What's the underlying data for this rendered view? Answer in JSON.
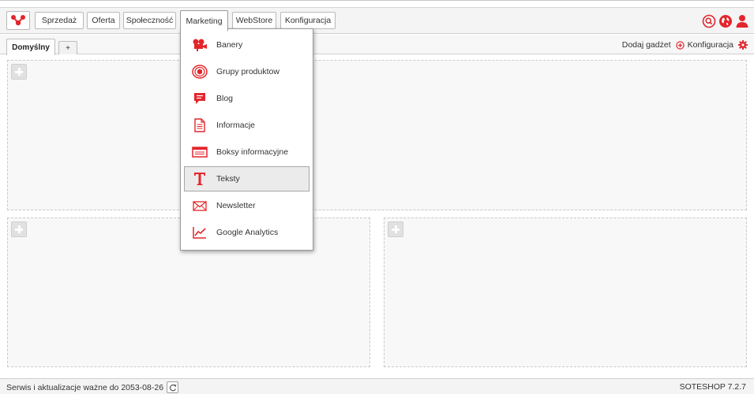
{
  "colors": {
    "accent": "#e3262c",
    "frame": "#d0d0d0",
    "box_bg": "#f8f8f8"
  },
  "topnav": {
    "logo_icon": "molecule-logo-icon",
    "items": [
      {
        "label": "Sprzedaż"
      },
      {
        "label": "Oferta"
      },
      {
        "label": "Społeczność"
      },
      {
        "label": "Marketing",
        "active": true
      },
      {
        "label": "WebStore"
      },
      {
        "label": "Konfiguracja"
      }
    ],
    "right_icons": [
      "search-icon",
      "globe-icon",
      "user-icon"
    ]
  },
  "tabs": {
    "items": [
      {
        "label": "Domyślny",
        "active": true
      },
      {
        "label": "+"
      }
    ],
    "add_gadget_label": "Dodaj gadżet",
    "config_label": "Konfiguracja"
  },
  "dropdown": {
    "items": [
      {
        "label": "Banery",
        "icon": "film-camera-icon"
      },
      {
        "label": "Grupy produktow",
        "icon": "product-group-icon"
      },
      {
        "label": "Blog",
        "icon": "chat-bubble-icon"
      },
      {
        "label": "Informacje",
        "icon": "document-icon"
      },
      {
        "label": "Boksy informacyjne",
        "icon": "info-box-icon"
      },
      {
        "label": "Teksty",
        "icon": "text-t-icon",
        "selected": true
      },
      {
        "label": "Newsletter",
        "icon": "envelope-icon"
      },
      {
        "label": "Google Analytics",
        "icon": "line-chart-icon"
      }
    ]
  },
  "footer": {
    "service_text": "Serwis i aktualizacje ważne do 2053-08-26",
    "version": "SOTESHOP 7.2.7"
  }
}
